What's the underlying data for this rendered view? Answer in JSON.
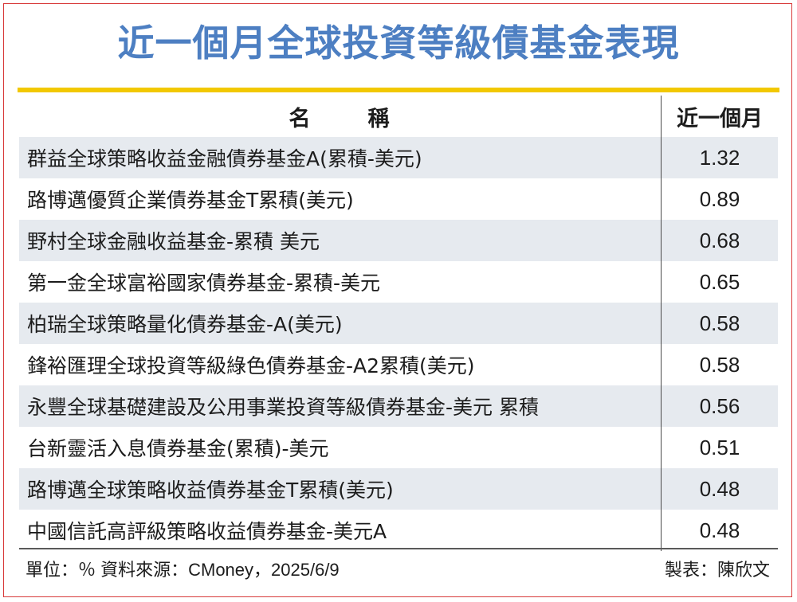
{
  "title": "近一個月全球投資等級債基金表現",
  "table": {
    "headers": {
      "name_a": "名",
      "name_b": "稱",
      "value": "近一個月"
    },
    "rows": [
      {
        "name": "群益全球策略收益金融債券基金A(累積-美元)",
        "value": "1.32"
      },
      {
        "name": "路博邁優質企業債券基金T累積(美元)",
        "value": "0.89"
      },
      {
        "name": "野村全球金融收益基金-累積 美元",
        "value": "0.68"
      },
      {
        "name": "第一金全球富裕國家債券基金-累積-美元",
        "value": "0.65"
      },
      {
        "name": "柏瑞全球策略量化債券基金-A(美元)",
        "value": "0.58"
      },
      {
        "name": "鋒裕匯理全球投資等級綠色債券基金-A2累積(美元)",
        "value": "0.58"
      },
      {
        "name": "永豐全球基礎建設及公用事業投資等級債券基金-美元 累積",
        "value": "0.56"
      },
      {
        "name": "台新靈活入息債券基金(累積)-美元",
        "value": "0.51"
      },
      {
        "name": "路博邁全球策略收益債券基金T累積(美元)",
        "value": "0.48"
      },
      {
        "name": "中國信託高評級策略收益債券基金-美元A",
        "value": "0.48"
      }
    ]
  },
  "footer": {
    "unit_source": "單位：％  資料來源：CMoney，2025/6/9",
    "credit": "製表：陳欣文"
  },
  "colors": {
    "title": "#4d7fc2",
    "rule": "#f2c800",
    "row_shade": "#e6eaef",
    "frame": "#d83a3a"
  }
}
